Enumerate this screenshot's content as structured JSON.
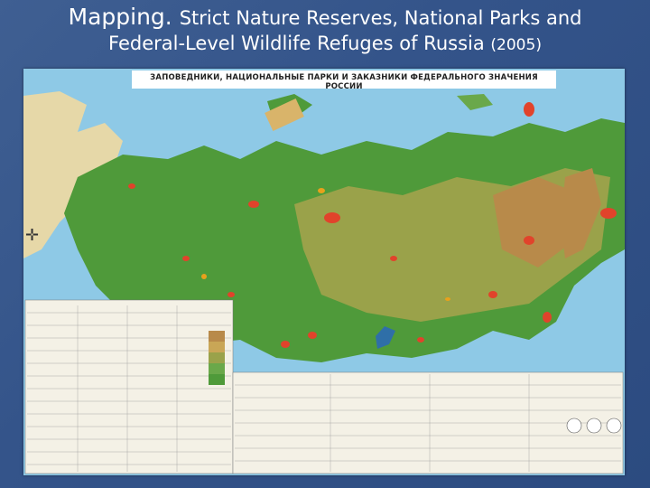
{
  "slide": {
    "title_main": "Mapping.",
    "title_sub": "Strict Nature Reserves, National Parks and",
    "title_line2": "Federal-Level Wildlife Refuges of Russia",
    "title_year": "(2005)"
  },
  "map": {
    "header": "ЗАПОВЕДНИКИ, НАЦИОНАЛЬНЫЕ ПАРКИ И ЗАКАЗНИКИ ФЕДЕРАЛЬНОГО ЗНАЧЕНИЯ РОССИИ",
    "compass_icon": "compass-rose-icon",
    "colors": {
      "sea": "#8ec9e6",
      "lowland": "#4f9a3a",
      "highland": "#9aa24a",
      "mountain": "#b88a4a",
      "reserve": "#e1432b",
      "refuge": "#e8a11c",
      "frame_bg": "#34548a"
    }
  }
}
